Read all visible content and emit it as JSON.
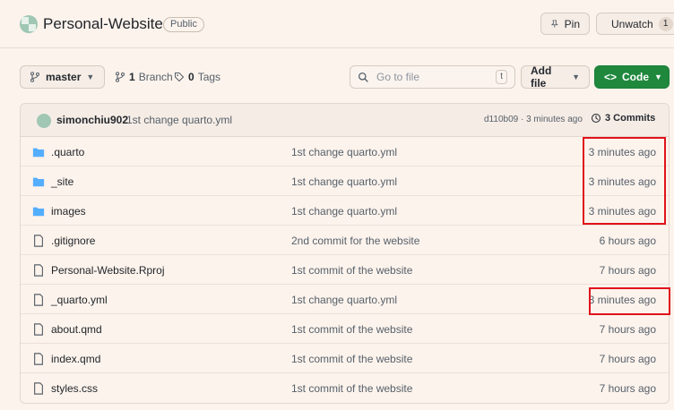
{
  "repo": {
    "name": "Personal-Website",
    "visibility": "Public",
    "pin_label": "Pin",
    "unwatch_label": "Unwatch",
    "watch_count": "1"
  },
  "toolbar": {
    "branch": "master",
    "branches_count": "1",
    "branches_label": "Branch",
    "tags_count": "0",
    "tags_label": "Tags",
    "search_placeholder": "Go to file",
    "search_shortcut": "t",
    "add_file_label": "Add file",
    "code_label": "Code"
  },
  "latest_commit": {
    "author": "simonchiu902",
    "message": "1st change quarto.yml",
    "meta": "d110b09 · 3 minutes ago",
    "commits_label": "3 Commits"
  },
  "files": [
    {
      "name": ".quarto",
      "type": "folder",
      "message": "1st change quarto.yml",
      "time": "3 minutes ago"
    },
    {
      "name": "_site",
      "type": "folder",
      "message": "1st change quarto.yml",
      "time": "3 minutes ago"
    },
    {
      "name": "images",
      "type": "folder",
      "message": "1st change quarto.yml",
      "time": "3 minutes ago"
    },
    {
      "name": ".gitignore",
      "type": "file",
      "message": "2nd commit for the website",
      "time": "6 hours ago"
    },
    {
      "name": "Personal-Website.Rproj",
      "type": "file",
      "message": "1st commit of the website",
      "time": "7 hours ago"
    },
    {
      "name": "_quarto.yml",
      "type": "file",
      "message": "1st change quarto.yml",
      "time": "3 minutes ago"
    },
    {
      "name": "about.qmd",
      "type": "file",
      "message": "1st commit of the website",
      "time": "7 hours ago"
    },
    {
      "name": "index.qmd",
      "type": "file",
      "message": "1st commit of the website",
      "time": "7 hours ago"
    },
    {
      "name": "styles.css",
      "type": "file",
      "message": "1st commit of the website",
      "time": "7 hours ago"
    }
  ],
  "colors": {
    "page_bg": "#fcf3ec",
    "code_button": "#1f883d",
    "folder_icon": "#54aeff",
    "highlight": "#e0121b"
  }
}
